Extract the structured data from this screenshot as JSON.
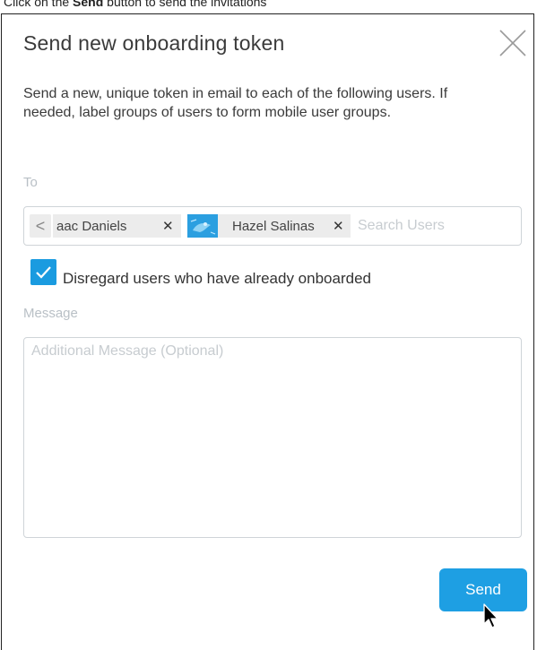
{
  "caption": {
    "prefix": "Click on the ",
    "bold": "Send",
    "suffix": " button to send the invitations"
  },
  "dialog": {
    "title": "Send new onboarding token",
    "description": "Send a new, unique token in email to each of the following users. If needed, label groups of users to form mobile user groups.",
    "to_label": "To",
    "recipients": [
      {
        "name": "aac Daniels",
        "remove": "✕"
      },
      {
        "name": "Hazel Salinas",
        "remove": "✕"
      }
    ],
    "search": {
      "placeholder": "Search Users",
      "value": ""
    },
    "scroll_left_glyph": "<",
    "checkbox": {
      "label": "Disregard users who have already onboarded",
      "checked": true
    },
    "message_label": "Message",
    "message": {
      "placeholder": "Additional Message (Optional)",
      "value": ""
    },
    "send_label": "Send"
  },
  "colors": {
    "accent": "#1e9fe3",
    "checkbox": "#1a9be0",
    "field_border": "#cfd4d8",
    "chip_bg": "#ececec"
  },
  "icons": {
    "close": "close-icon",
    "checkmark": "checkmark-icon",
    "avatar": "avatar-icon",
    "cursor": "mouse-pointer-icon"
  }
}
